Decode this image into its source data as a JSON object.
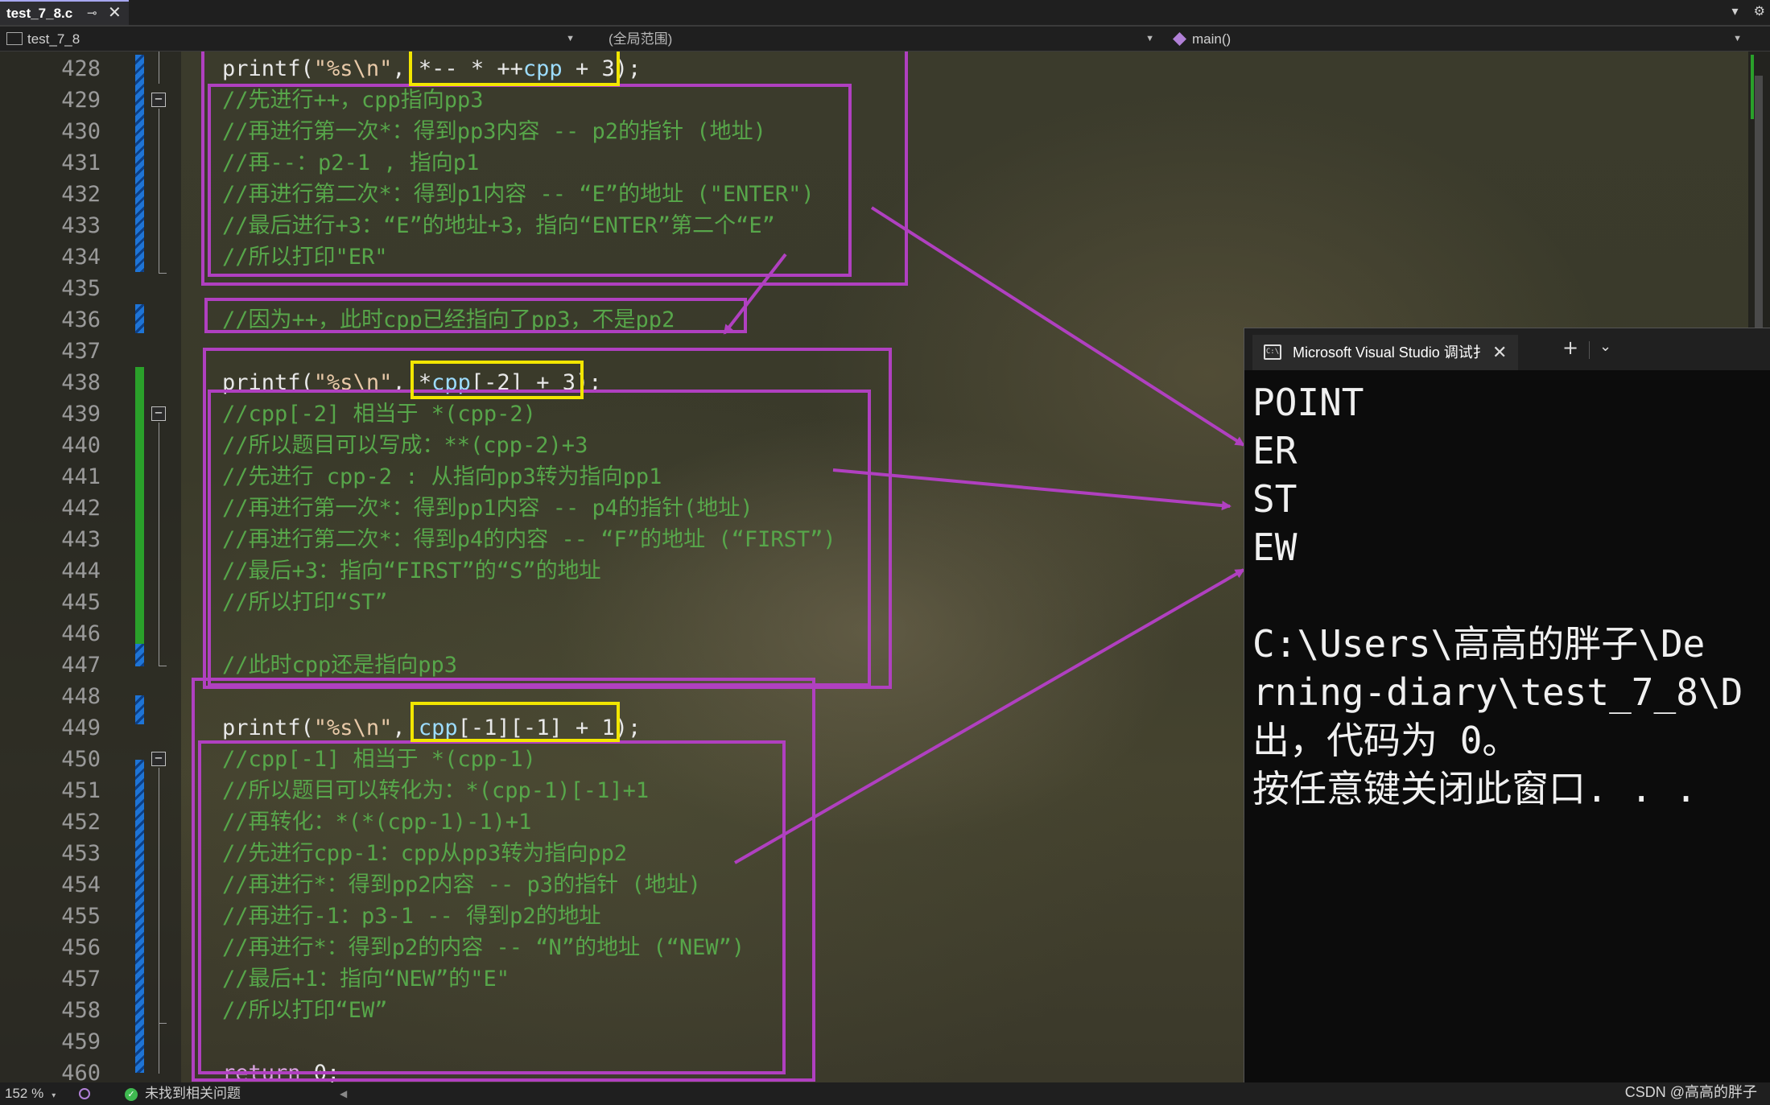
{
  "tab": {
    "title": "test_7_8.c",
    "pin": "⊸",
    "close": "✕"
  },
  "titlebar_icons": {
    "dropdown": "▾",
    "settings": "⚙"
  },
  "navbar": {
    "project": "test_7_8",
    "scope": "(全局范围)",
    "function": "main()"
  },
  "editor": {
    "line_numbers": [
      "428",
      "429",
      "430",
      "431",
      "432",
      "433",
      "434",
      "435",
      "436",
      "437",
      "438",
      "439",
      "440",
      "441",
      "442",
      "443",
      "444",
      "445",
      "446",
      "447",
      "448",
      "449",
      "450",
      "451",
      "452",
      "453",
      "454",
      "455",
      "456",
      "457",
      "458",
      "459",
      "460"
    ],
    "lines": {
      "l428_pre": "printf(",
      "l428_str": "\"%s",
      "l428_esc": "\\n",
      "l428_str2": "\"",
      "l428_rest": ", *-- * ++",
      "l428_var": "cpp",
      "l428_end": " + 3);",
      "l429": "//先进行++，cpp指向pp3",
      "l430": "//再进行第一次*：得到pp3内容 -- p2的指针 (地址)",
      "l431": "//再--：p2-1 , 指向p1",
      "l432": "//再进行第二次*：得到p1内容 -- “E”的地址 (\"ENTER\")",
      "l433": "//最后进行+3：“E”的地址+3，指向“ENTER”第二个“E”",
      "l434": "//所以打印\"ER\"",
      "l436": "//因为++，此时cpp已经指向了pp3，不是pp2",
      "l438_pre": "printf(",
      "l438_str": "\"%s",
      "l438_esc": "\\n",
      "l438_str2": "\"",
      "l438_mid": ", *",
      "l438_var": "cpp",
      "l438_end": "[-2] + 3);",
      "l439": "//cpp[-2] 相当于 *(cpp-2)",
      "l440": "//所以题目可以写成：**(cpp-2)+3",
      "l441": "//先进行 cpp-2 : 从指向pp3转为指向pp1",
      "l442": "//再进行第一次*：得到pp1内容 -- p4的指针(地址)",
      "l443": "//再进行第二次*：得到p4的内容 -- “F”的地址 (“FIRST”)",
      "l444": "//最后+3：指向“FIRST”的“S”的地址",
      "l445": "//所以打印“ST”",
      "l447": "//此时cpp还是指向pp3",
      "l449_pre": "printf(",
      "l449_str": "\"%s",
      "l449_esc": "\\n",
      "l449_str2": "\"",
      "l449_mid": ", ",
      "l449_var": "cpp",
      "l449_end": "[-1][-1] + 1);",
      "l450": "//cpp[-1] 相当于 *(cpp-1)",
      "l451": "//所以题目可以转化为：*(cpp-1)[-1]+1",
      "l452": "//再转化：*(*(cpp-1)-1)+1",
      "l453": "//先进行cpp-1：cpp从pp3转为指向pp2",
      "l454": "//再进行*：得到pp2内容 -- p3的指针 (地址)",
      "l455": "//再进行-1：p3-1 -- 得到p2的地址",
      "l456": "//再进行*：得到p2的内容 -- “N”的地址 (“NEW”)",
      "l457": "//最后+1：指向“NEW”的\"E\"",
      "l458": "//所以打印“EW”",
      "l460_kw": "return",
      "l460_rest": " 0;"
    },
    "fold_glyph": "−"
  },
  "console": {
    "title": "Microsoft Visual Studio 调试扌",
    "icon": "C:\\",
    "close": "✕",
    "plus": "+",
    "dropdown": "⌄",
    "output_lines": [
      "POINT",
      "ER",
      "ST",
      "EW",
      "",
      "C:\\Users\\高高的胖子\\De",
      "rning-diary\\test_7_8\\D",
      "出，代码为 0。",
      "按任意键关闭此窗口. . ."
    ]
  },
  "statusbar": {
    "zoom": "152 %",
    "zoom_caret": "▾",
    "ok_glyph": "✓",
    "issues": "未找到相关问题",
    "scroll_left": "◀",
    "watermark": "CSDN @高高的胖子"
  },
  "colors": {
    "annotation_box": "#b040c0",
    "highlight_box": "#f2e600",
    "comment": "#57a64a",
    "string": "#e8c9a8",
    "variable": "#9cdcfe",
    "keyword": "#d8a0df",
    "arrow": "#b040c0"
  }
}
